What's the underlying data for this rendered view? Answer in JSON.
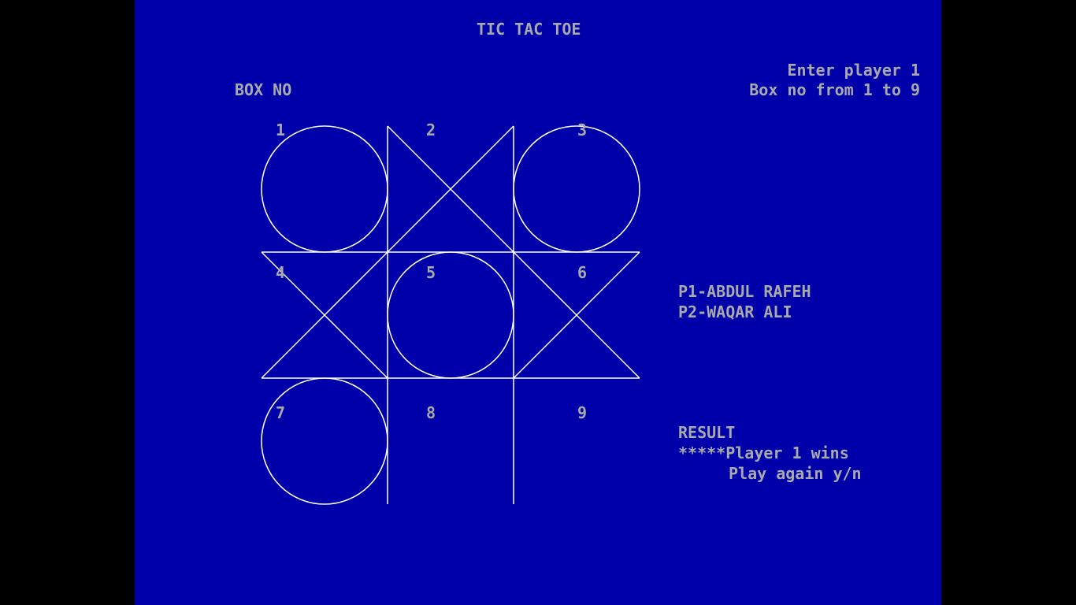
{
  "header": {
    "title": "TIC TAC TOE"
  },
  "board_label": "BOX NO",
  "prompt": {
    "line1": "Enter player 1",
    "line2": "Box no from 1 to 9"
  },
  "players": {
    "p1": "P1-ABDUL RAFEH",
    "p2": "P2-WAQAR ALI"
  },
  "result": {
    "label": "RESULT",
    "message": "*****Player 1 wins",
    "play_again": "Play again y/n"
  },
  "board": {
    "box_numbers": [
      "1",
      "2",
      "3",
      "4",
      "5",
      "6",
      "7",
      "8",
      "9"
    ],
    "marks": [
      "O",
      "X",
      "O",
      "X",
      "O",
      "X",
      "O",
      "",
      ""
    ]
  },
  "colors": {
    "background": "#0000aa",
    "text": "#aaaaaa",
    "lines": "#ffffff",
    "letterbox": "#000000"
  }
}
